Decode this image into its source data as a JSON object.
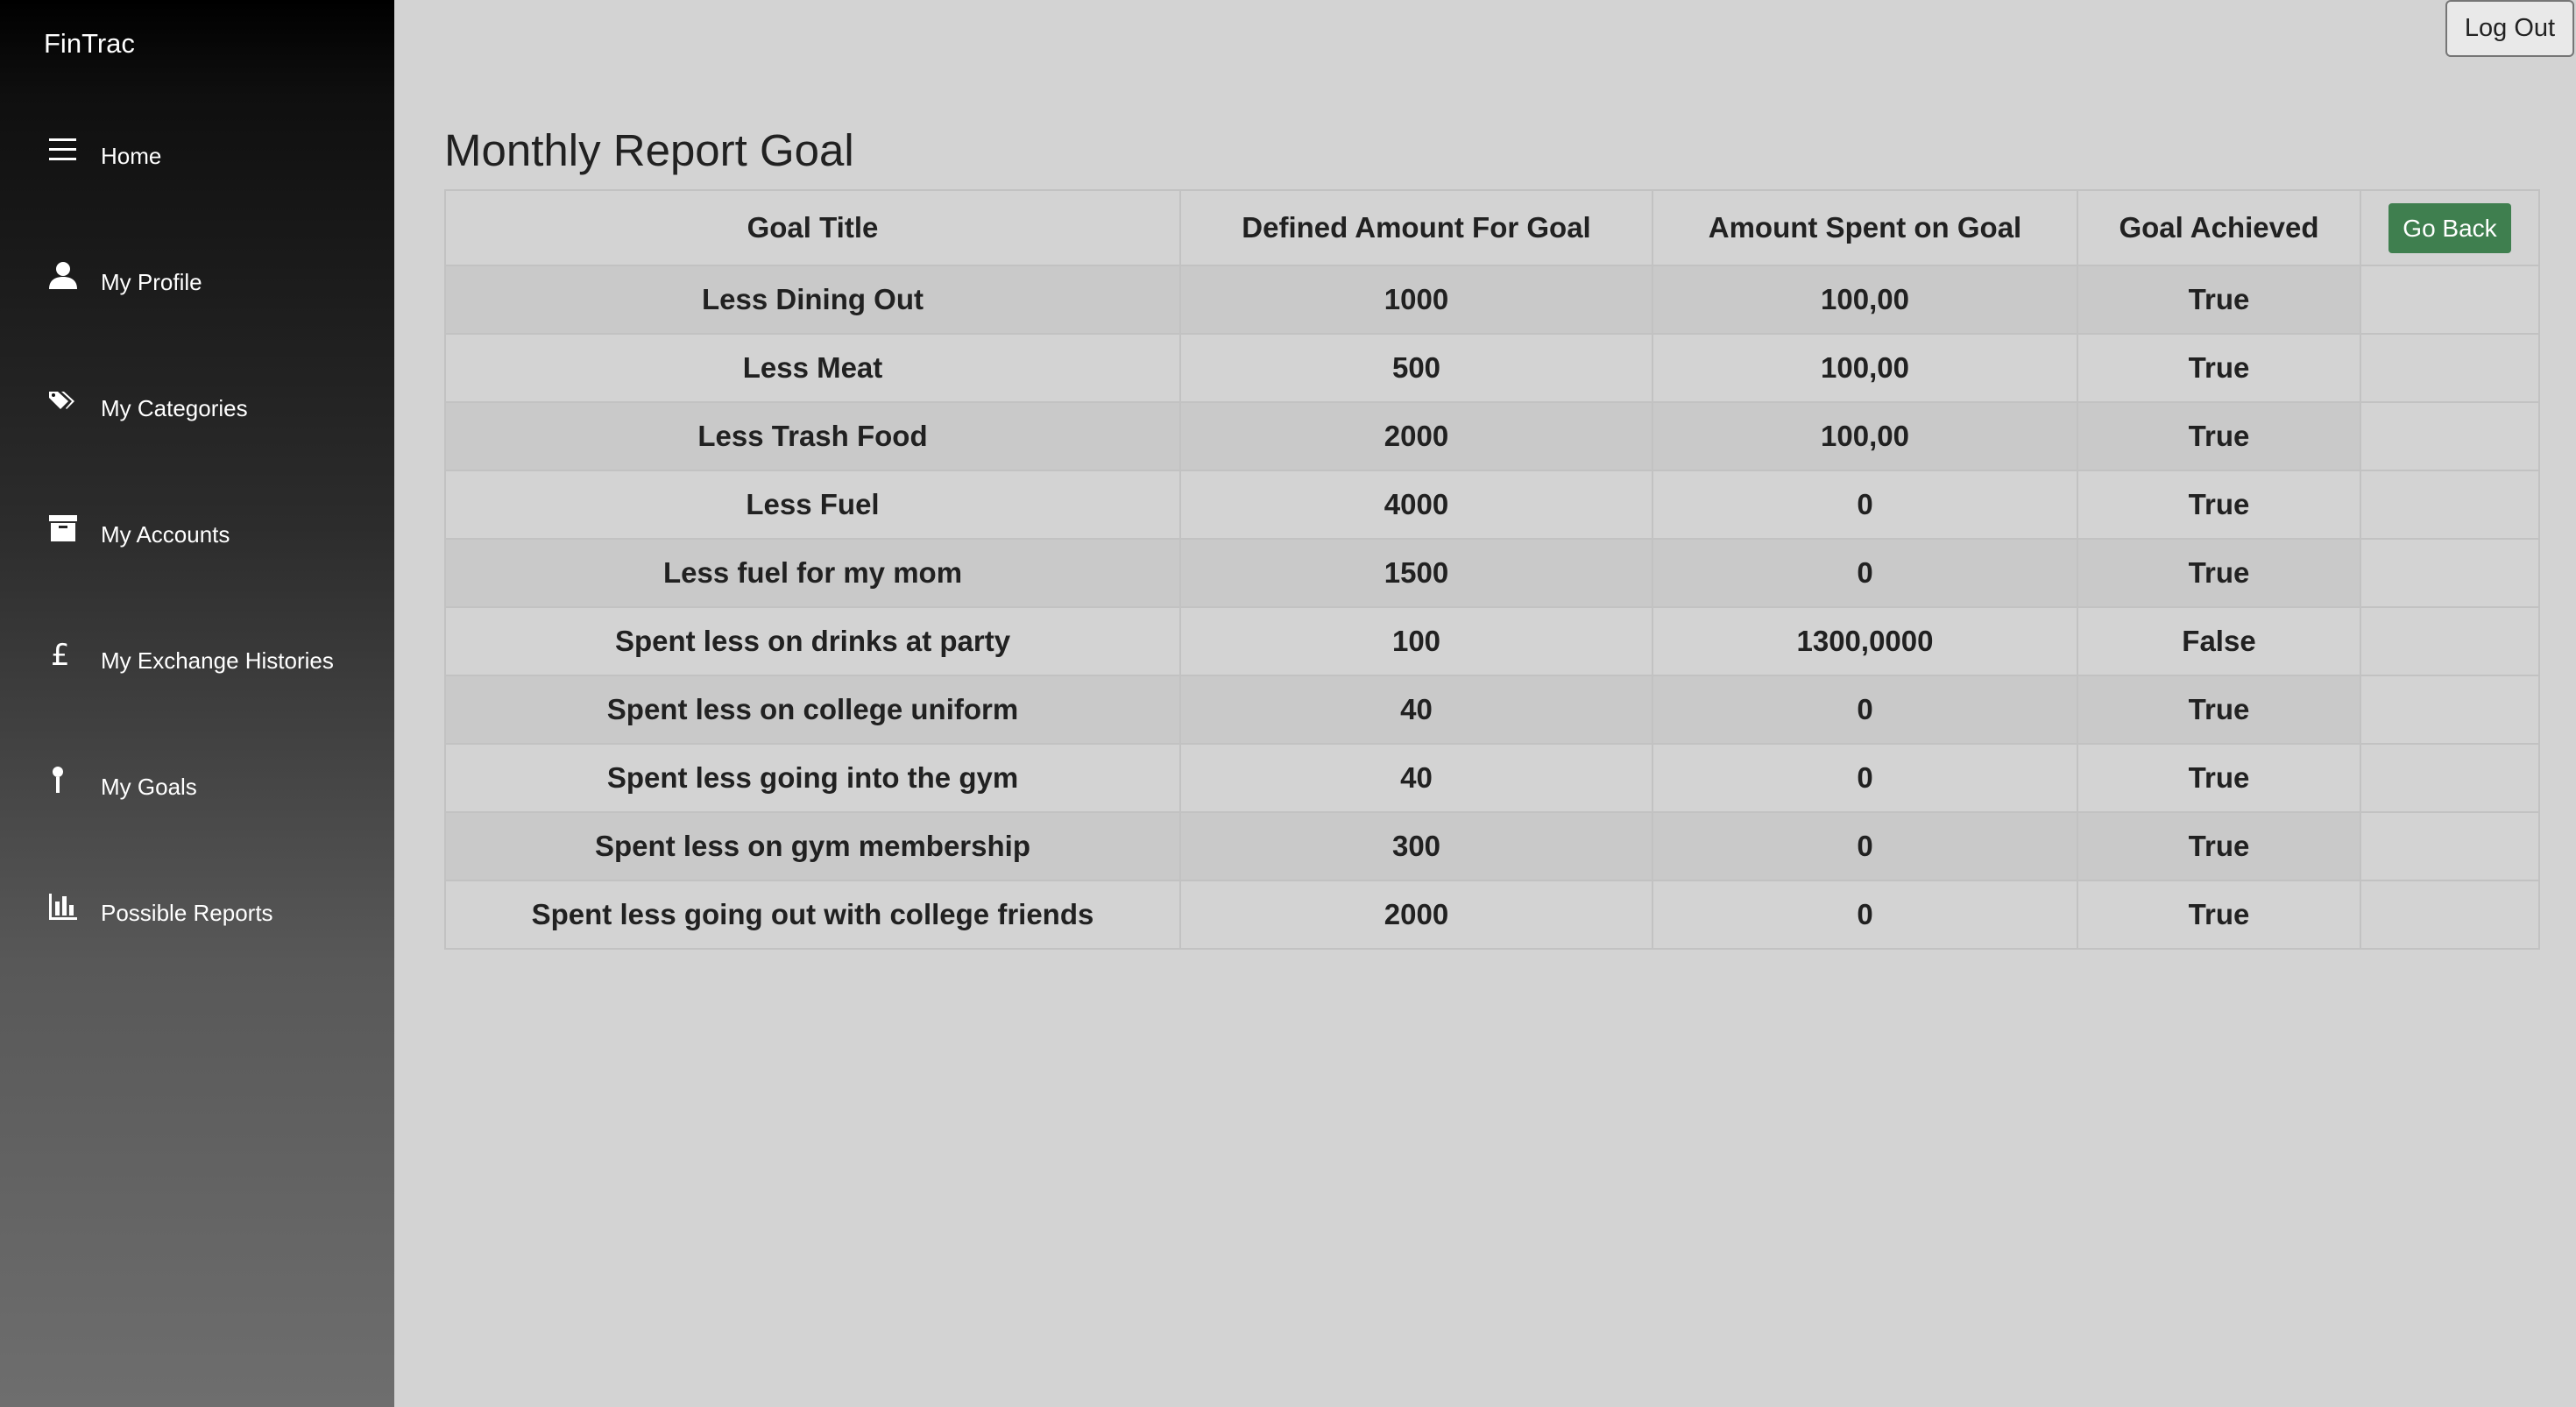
{
  "app": {
    "brand": "FinTrac"
  },
  "sidebar": {
    "items": [
      {
        "label": "Home",
        "icon": "menu-icon"
      },
      {
        "label": "My Profile",
        "icon": "user-icon"
      },
      {
        "label": "My Categories",
        "icon": "tags-icon"
      },
      {
        "label": "My Accounts",
        "icon": "archive-icon"
      },
      {
        "label": "My Exchange Histories",
        "icon": "pound-icon"
      },
      {
        "label": "My Goals",
        "icon": "pin-icon"
      },
      {
        "label": "Possible Reports",
        "icon": "bar-chart-icon"
      }
    ]
  },
  "header": {
    "logout_label": "Log Out"
  },
  "main": {
    "title": "Monthly Report Goal",
    "go_back_label": "Go Back",
    "table": {
      "headers": [
        "Goal Title",
        "Defined Amount For Goal",
        "Amount Spent on Goal",
        "Goal Achieved"
      ],
      "rows": [
        [
          "Less Dining Out",
          "1000",
          "100,00",
          "True"
        ],
        [
          "Less Meat",
          "500",
          "100,00",
          "True"
        ],
        [
          "Less Trash Food",
          "2000",
          "100,00",
          "True"
        ],
        [
          "Less Fuel",
          "4000",
          "0",
          "True"
        ],
        [
          "Less fuel for my mom",
          "1500",
          "0",
          "True"
        ],
        [
          "Spent less on drinks at party",
          "100",
          "1300,0000",
          "False"
        ],
        [
          "Spent less on college uniform",
          "40",
          "0",
          "True"
        ],
        [
          "Spent less going into the gym",
          "40",
          "0",
          "True"
        ],
        [
          "Spent less on gym membership",
          "300",
          "0",
          "True"
        ],
        [
          "Spent less going out with college friends",
          "2000",
          "0",
          "True"
        ]
      ]
    }
  }
}
